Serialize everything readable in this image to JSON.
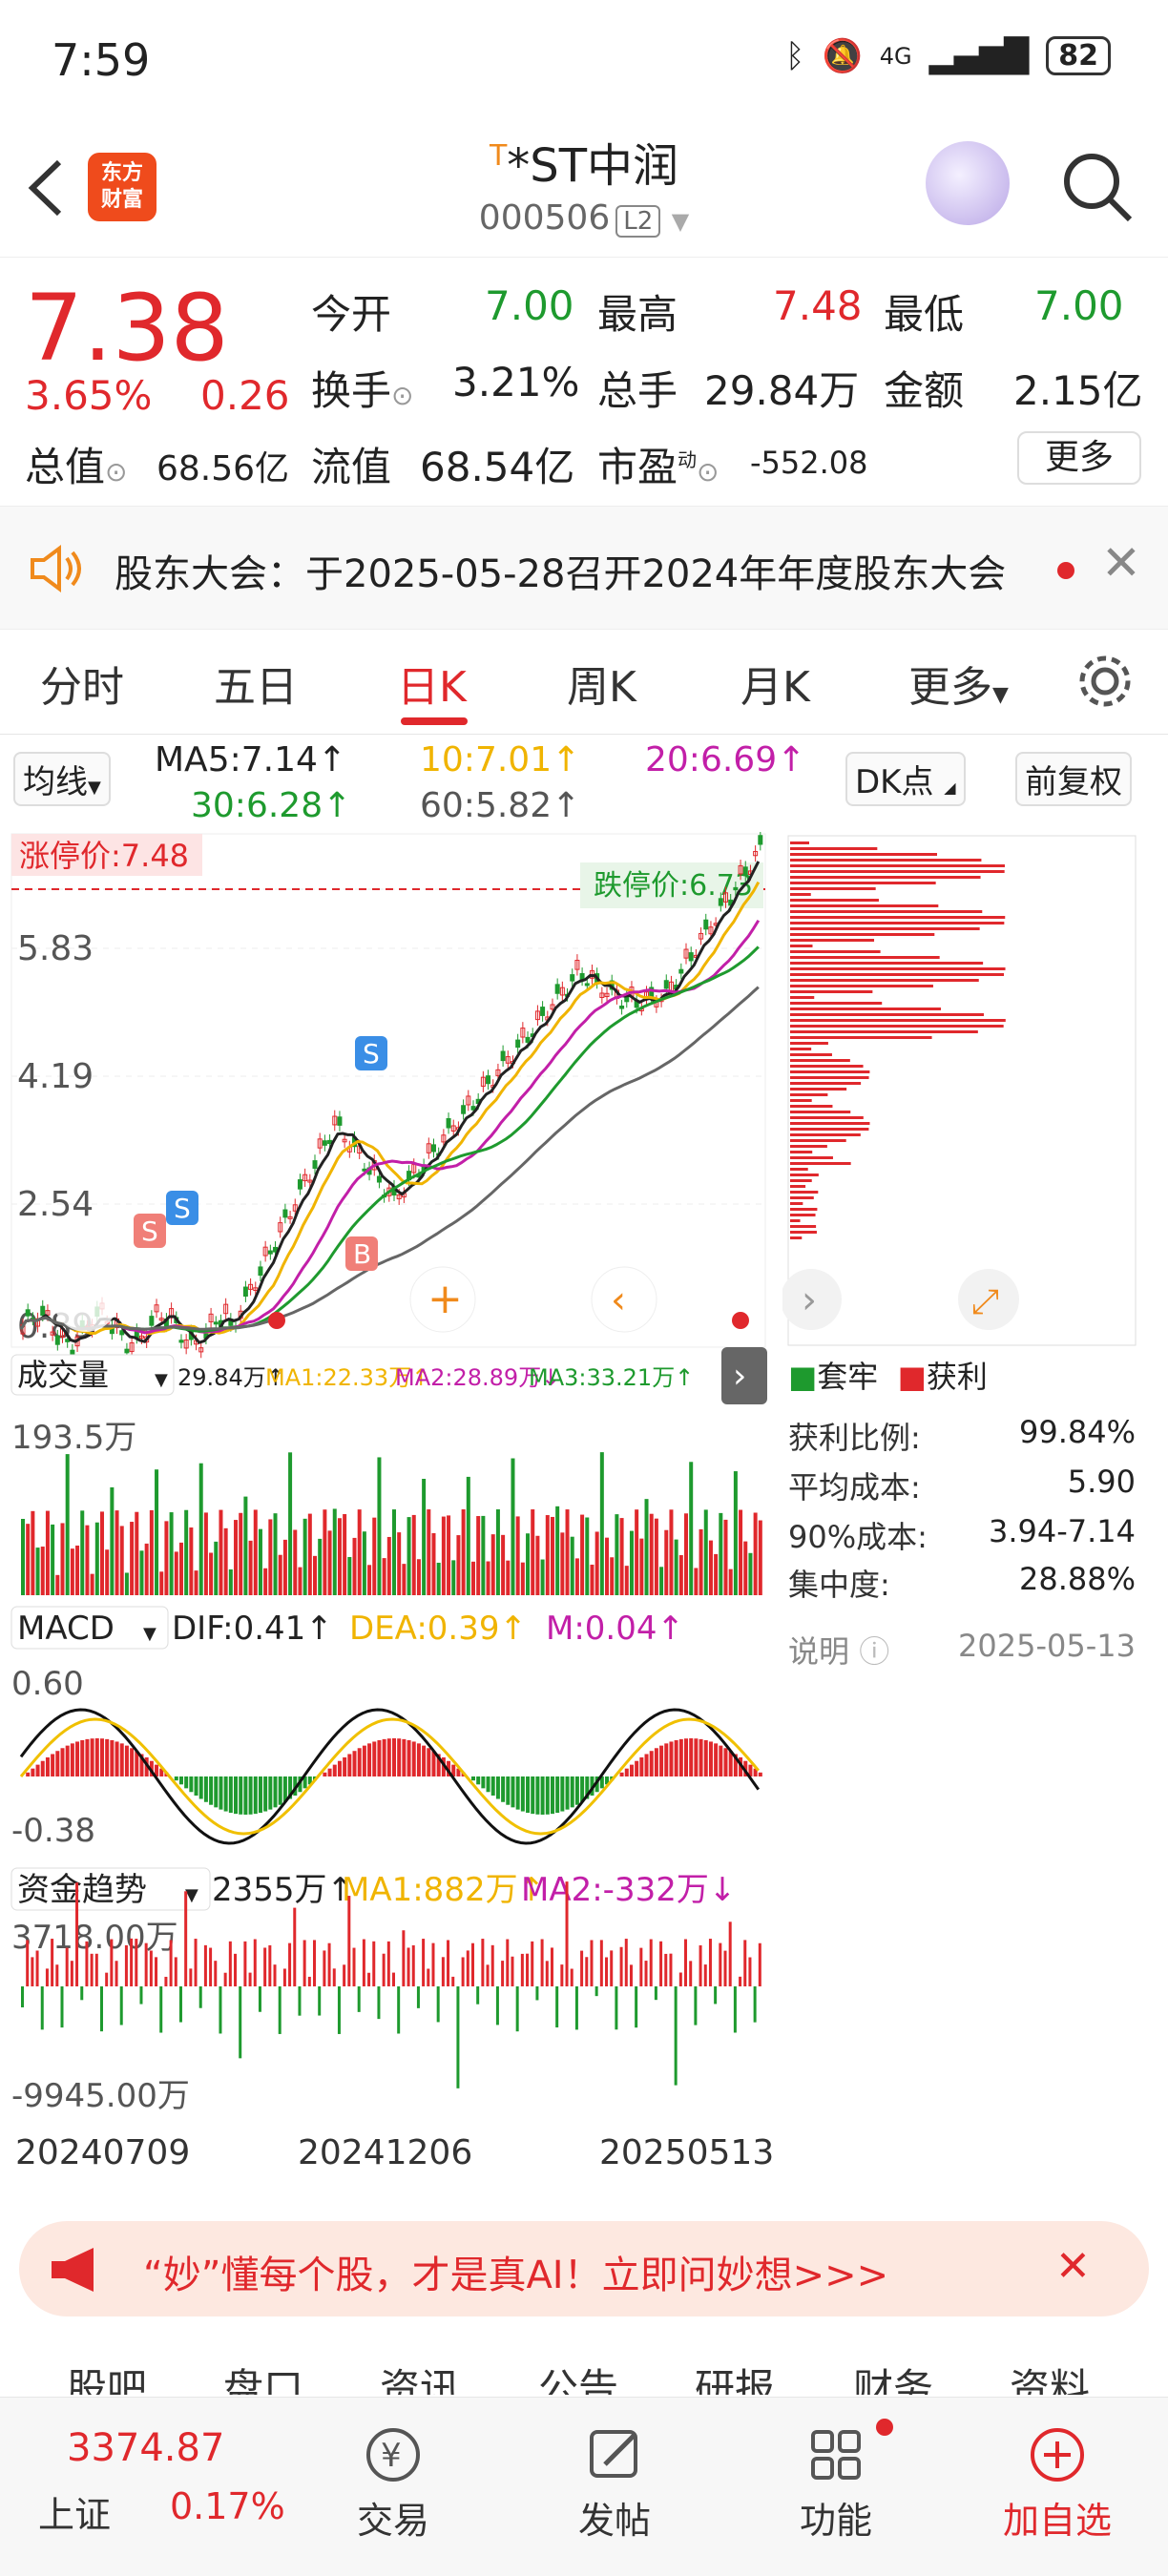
{
  "status_bar": {
    "time": "7:59",
    "network": "4G",
    "battery": "82"
  },
  "header": {
    "logo_text_1": "东方",
    "logo_text_2": "财富",
    "title_prefix": "T",
    "title": "*ST中润",
    "code": "000506",
    "level": "L2"
  },
  "quote": {
    "price": "7.38",
    "change_pct": "3.65%",
    "change_amt": "0.26",
    "fields": [
      {
        "label": "今开",
        "value": "7.00",
        "color": "green"
      },
      {
        "label": "最高",
        "value": "7.48",
        "color": "red"
      },
      {
        "label": "最低",
        "value": "7.00",
        "color": "green"
      },
      {
        "label": "换手",
        "value": "3.21%",
        "color": "dark"
      },
      {
        "label": "总手",
        "value": "29.84万",
        "color": "dark"
      },
      {
        "label": "金额",
        "value": "2.15亿",
        "color": "dark"
      },
      {
        "label": "总值",
        "value": "68.56亿",
        "color": "dark"
      },
      {
        "label": "流值",
        "value": "68.54亿",
        "color": "dark"
      },
      {
        "label": "市盈",
        "value": "-552.08",
        "color": "dark"
      }
    ],
    "pe_mark": "动",
    "more_label": "更多"
  },
  "notice": {
    "text": "股东大会：于2025-05-28召开2024年年度股东大会"
  },
  "tabs": [
    "分时",
    "五日",
    "日K",
    "周K",
    "月K",
    "更多"
  ],
  "active_tab": "日K",
  "ma_bar": {
    "select": "均线",
    "ma5": "MA5:7.14↑",
    "ma10": "10:7.01↑",
    "ma20": "20:6.69↑",
    "ma30": "30:6.28↑",
    "ma60": "60:5.82↑",
    "dk": "DK点",
    "adjust": "前复权"
  },
  "kline": {
    "limit_up": "涨停价:7.48",
    "limit_down": "跌停价:6.73",
    "y_labels": [
      "5.83",
      "4.19",
      "2.54",
      "0.89"
    ],
    "signals": {
      "s": "S",
      "b": "B"
    }
  },
  "volume": {
    "select": "成交量",
    "v": "29.84万↑",
    "ma1": "MA1:22.33万↑",
    "ma2": "MA2:28.89万↓",
    "ma3": "MA3:33.21万↑",
    "top": "193.5万"
  },
  "macd": {
    "select": "MACD",
    "dif": "DIF:0.41↑",
    "dea": "DEA:0.39↑",
    "m": "M:0.04↑",
    "top": "0.60",
    "bottom": "-0.38"
  },
  "fund": {
    "select": "资金趋势",
    "v": "2355万↑",
    "ma1": "MA1:882万↑",
    "ma2": "MA2:-332万↓",
    "top": "3718.00万",
    "bottom": "-9945.00万"
  },
  "dates": [
    "20240709",
    "20241206",
    "20250513"
  ],
  "chip": {
    "legend_trapped": "套牢",
    "legend_profit": "获利",
    "rows": [
      {
        "k": "获利比例:",
        "v": "99.84%"
      },
      {
        "k": "平均成本:",
        "v": "5.90"
      },
      {
        "k": "90%成本:",
        "v": "3.94-7.14"
      },
      {
        "k": "集中度:",
        "v": "28.88%"
      }
    ],
    "note": "说明",
    "date": "2025-05-13"
  },
  "banner": {
    "text": "“妙”懂每个股，才是真AI！立即问妙想>>>"
  },
  "sub_tabs": [
    "股吧",
    "盘口",
    "资讯",
    "公告",
    "研报",
    "财务",
    "资料"
  ],
  "bottom_bar": {
    "index_value": "3374.87",
    "index_name": "上证",
    "index_change": "0.17%",
    "items": [
      "交易",
      "发帖",
      "功能",
      "加自选"
    ]
  },
  "colors": {
    "red": "#e0282c",
    "green": "#1e9a2e",
    "orange": "#f08a1c"
  }
}
